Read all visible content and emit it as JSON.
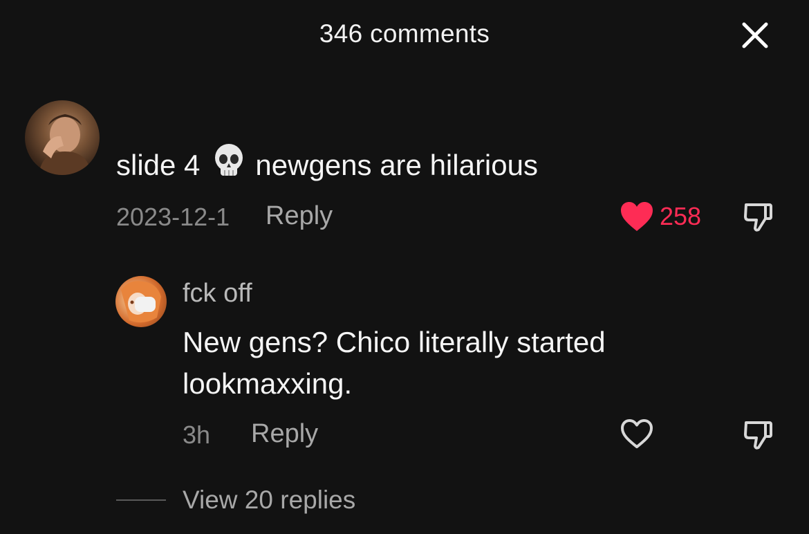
{
  "header": {
    "title": "346 comments",
    "close_icon": "close-icon"
  },
  "comment": {
    "text_before_emoji": "slide 4",
    "emoji": "skull-emoji",
    "text_after_emoji": "newgens are hilarious",
    "date": "2023-12-1",
    "reply_label": "Reply",
    "like_count": "258",
    "liked": true,
    "like_color": "#fe2c55"
  },
  "reply": {
    "username": "fck off",
    "text": "New gens? Chico literally started lookmaxxing.",
    "time": "3h",
    "reply_label": "Reply",
    "liked": false
  },
  "view_replies_label": "View 20 replies"
}
